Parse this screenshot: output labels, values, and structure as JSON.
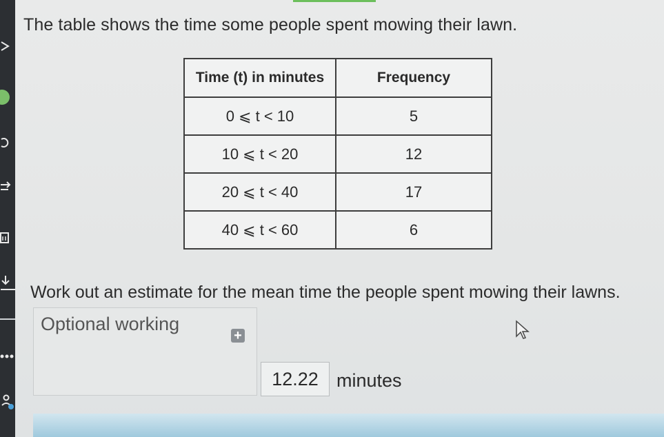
{
  "question": {
    "text": "The table shows the time some people spent mowing their lawn."
  },
  "table": {
    "headers": [
      "Time (t) in minutes",
      "Frequency"
    ],
    "rows": [
      {
        "time": "0 ⩽ t < 10",
        "frequency": "5"
      },
      {
        "time": "10 ⩽ t < 20",
        "frequency": "12"
      },
      {
        "time": "20 ⩽ t < 40",
        "frequency": "17"
      },
      {
        "time": "40 ⩽ t < 60",
        "frequency": "6"
      }
    ]
  },
  "instruction": "Work out an estimate for the mean time the people spent mowing their lawns.",
  "working": {
    "label": "Optional working",
    "add_icon": "plus-icon"
  },
  "answer": {
    "value": "12.22",
    "unit": "minutes"
  },
  "sidebar": {
    "icons": [
      "chevron-right-icon",
      "status-dot-icon",
      "refresh-icon",
      "swap-icon",
      "calculator-icon",
      "download-icon",
      "more-icon",
      "accessibility-icon"
    ]
  },
  "colors": {
    "sidebar": "#2c2f33",
    "accent_green": "#6cbf5c",
    "bottom_bar": "#9fc9dd"
  }
}
